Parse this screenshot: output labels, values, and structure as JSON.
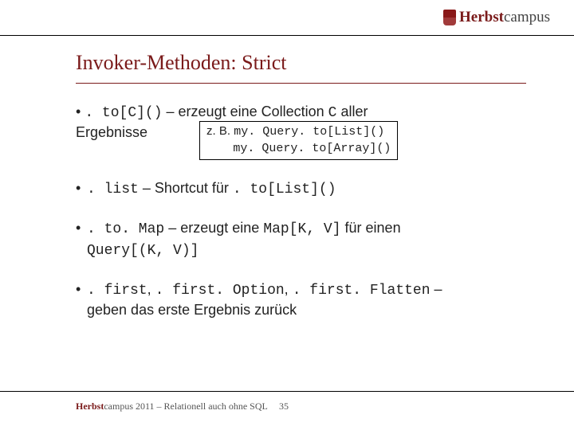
{
  "header": {
    "brand1": "Herbst",
    "brand2": "campus"
  },
  "title": "Invoker-Methoden: Strict",
  "bullets": {
    "b1": {
      "code1": ". to[C]()",
      "text1": " – erzeugt eine Collection ",
      "code2": "C",
      "text2": " aller",
      "text3": "Ergebnisse"
    },
    "example": {
      "prefix": "z. B. ",
      "line1": "my. Query. to[List]()",
      "line2pad": "        ",
      "line2": "my. Query. to[Array]()"
    },
    "b2": {
      "code1": ". list",
      "text1": " – Shortcut für ",
      "code2": ". to[List]()"
    },
    "b3": {
      "code1": ". to. Map",
      "text1": " – erzeugt eine ",
      "code2": "Map[K, V]",
      "text2": " für einen",
      "code3": "Query[(K, V)]"
    },
    "b4": {
      "code1": ". first",
      "sep1": ", ",
      "code2": ". first. Option",
      "sep2": ", ",
      "code3": ". first. Flatten",
      "text1": " –",
      "text2": "geben das erste Ergebnis zurück"
    }
  },
  "footer": {
    "brand": "Herbst",
    "rest": "campus 2011 – Relationell auch ohne SQL",
    "page": "35"
  }
}
